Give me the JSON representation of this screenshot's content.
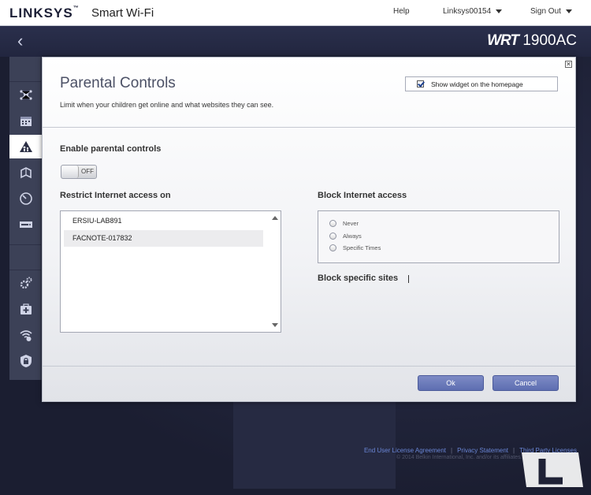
{
  "header": {
    "logo": "LINKSYS",
    "logo_tm": "™",
    "product": "Smart Wi-Fi",
    "help": "Help",
    "account": "Linksys00154",
    "signout": "Sign Out"
  },
  "band": {
    "back_glyph": "‹",
    "model_prefix": "WRT",
    "model_suffix": "1900AC"
  },
  "sidebar": {
    "icons": [
      "network-map-icon",
      "calendar-icon",
      "parental-controls-icon",
      "media-prioritization-icon",
      "speed-test-icon",
      "external-storage-icon",
      "connectivity-icon",
      "troubleshooting-icon",
      "wireless-icon",
      "security-icon"
    ],
    "active_icon": "parental-controls-icon"
  },
  "modal": {
    "close_glyph": "✕",
    "title": "Parental Controls",
    "description": "Limit when your children get online and what websites they can see.",
    "widget_label": "Show widget on the homepage",
    "widget_checked": true,
    "enable_label": "Enable parental controls",
    "toggle_state": "OFF",
    "restrict_label": "Restrict Internet access on",
    "devices": [
      "ERSIU-LAB891",
      "FACNOTE-017832"
    ],
    "selected_device": "FACNOTE-017832",
    "block_access_label": "Block Internet access",
    "block_options": [
      "Never",
      "Always",
      "Specific Times"
    ],
    "block_sites_label": "Block specific sites",
    "ok_label": "Ok",
    "cancel_label": "Cancel"
  },
  "footer": {
    "links": [
      "End User License Agreement",
      "Privacy Statement",
      "Third Party Licenses"
    ],
    "separator": "|",
    "copyright": "© 2014 Belkin International, Inc. and/or its affiliates."
  },
  "colors": {
    "accent_button": "#6776b8",
    "sidebar_bg": "#3c4157",
    "header_band": "#262a44",
    "link": "#6a86d6"
  }
}
